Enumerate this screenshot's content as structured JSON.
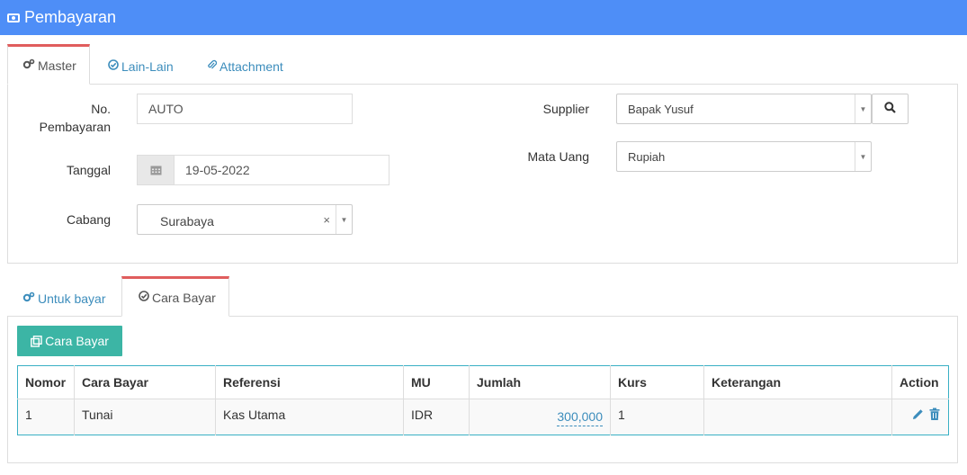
{
  "header": {
    "title": "Pembayaran",
    "icon": "money-icon"
  },
  "top_tabs": [
    {
      "label": "Master",
      "icon": "cogs-icon",
      "active": true
    },
    {
      "label": "Lain-Lain",
      "icon": "check-circle-icon",
      "active": false
    },
    {
      "label": "Attachment",
      "icon": "paperclip-icon",
      "active": false
    }
  ],
  "form": {
    "no_pembayaran": {
      "label_line1": "No.",
      "label_line2": "Pembayaran",
      "value": "AUTO"
    },
    "tanggal": {
      "label": "Tanggal",
      "value": "19-05-2022",
      "icon": "calendar-icon"
    },
    "cabang": {
      "label": "Cabang",
      "value": "Surabaya",
      "clear": "×",
      "arrow": "▼"
    },
    "supplier": {
      "label": "Supplier",
      "value": "Bapak Yusuf",
      "arrow": "▼"
    },
    "mata_uang": {
      "label": "Mata Uang",
      "value": "Rupiah",
      "arrow": "▼"
    }
  },
  "bottom_tabs": [
    {
      "label": "Untuk bayar",
      "icon": "cogs-icon",
      "active": false
    },
    {
      "label": "Cara Bayar",
      "icon": "check-circle-icon",
      "active": true
    }
  ],
  "cara_bayar_button": {
    "label": "Cara Bayar",
    "icon": "copy-icon"
  },
  "table": {
    "columns": [
      "Nomor",
      "Cara Bayar",
      "Referensi",
      "MU",
      "Jumlah",
      "Kurs",
      "Keterangan",
      "Action"
    ],
    "rows": [
      {
        "nomor": "1",
        "cara_bayar": "Tunai",
        "referensi": "Kas Utama",
        "mu": "IDR",
        "jumlah": "300,000",
        "kurs": "1",
        "keterangan": ""
      }
    ]
  },
  "colors": {
    "topbar": "#4e8ef7",
    "accent_tab": "#e05d5d",
    "button": "#3cb5a5",
    "link": "#3c8dbc",
    "table_border": "#3ab0c5"
  }
}
